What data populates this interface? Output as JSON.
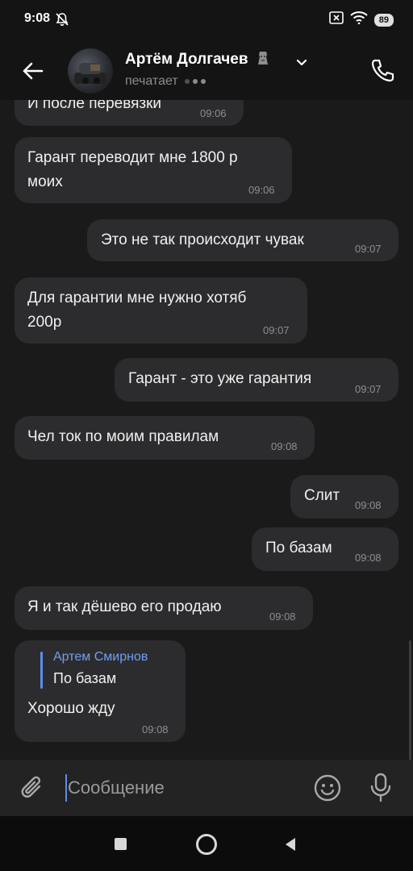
{
  "status_bar": {
    "time": "9:08",
    "battery": "89"
  },
  "header": {
    "name": "Артём Долгачев",
    "status": "печатает"
  },
  "messages": [
    {
      "text": "И после перевязки",
      "time": "09:06",
      "side": "in"
    },
    {
      "text": "Гарант переводит мне 1800 р\nмоих",
      "time": "09:06",
      "side": "in"
    },
    {
      "text": "Это не так происходит чувак",
      "time": "09:07",
      "side": "out"
    },
    {
      "text": "Для гарантии мне нужно хотяб\n200р",
      "time": "09:07",
      "side": "in"
    },
    {
      "text": "Гарант - это уже гарантия",
      "time": "09:07",
      "side": "out"
    },
    {
      "text": "Чел ток по моим правилам",
      "time": "09:08",
      "side": "in"
    },
    {
      "text": "Слит",
      "time": "09:08",
      "side": "out"
    },
    {
      "text": "По базам",
      "time": "09:08",
      "side": "out"
    },
    {
      "text": "Я и так дёшево его продаю",
      "time": "09:08",
      "side": "in"
    },
    {
      "text": "Хорошо жду",
      "time": "09:08",
      "side": "in",
      "reply": {
        "author": "Артем Смирнов",
        "text": "По базам"
      }
    }
  ],
  "composer": {
    "placeholder": "Сообщение"
  },
  "colors": {
    "background": "#1a1a1a",
    "bubble": "#2c2c2e",
    "accent": "#5b8def"
  },
  "icons": [
    "silent-bell-icon",
    "sim-icon",
    "wifi-icon",
    "back-arrow-icon",
    "chevron-down-icon",
    "phone-icon",
    "attach-icon",
    "smile-icon",
    "mic-icon"
  ]
}
